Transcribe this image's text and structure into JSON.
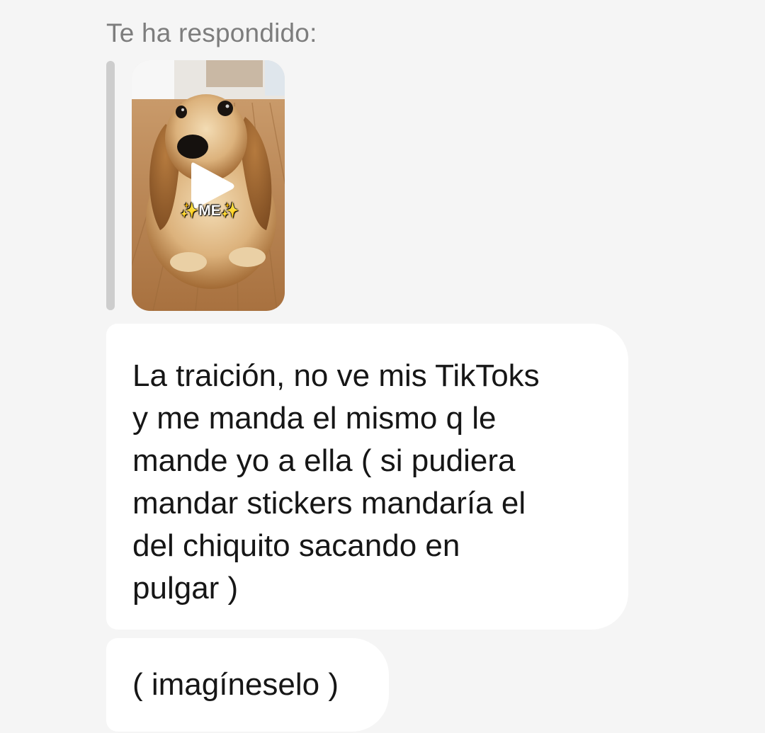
{
  "reply": {
    "header_label": "Te ha respondido:",
    "video": {
      "caption": "✨ME✨",
      "play_icon": "play-icon"
    }
  },
  "messages": [
    {
      "lines": [
        "La traición, no ve mis TikToks",
        "y me manda el mismo q le",
        "mande yo a ella ( si pudiera",
        "mandar stickers mandaría el",
        "del chiquito sacando en",
        "pulgar )"
      ]
    },
    {
      "lines": [
        "( imagíneselo )"
      ]
    }
  ],
  "colors": {
    "background": "#f5f5f5",
    "bubble": "#ffffff",
    "reply_bar": "#cdcdcd",
    "header_text": "#7d7d7d",
    "message_text": "#161616"
  }
}
